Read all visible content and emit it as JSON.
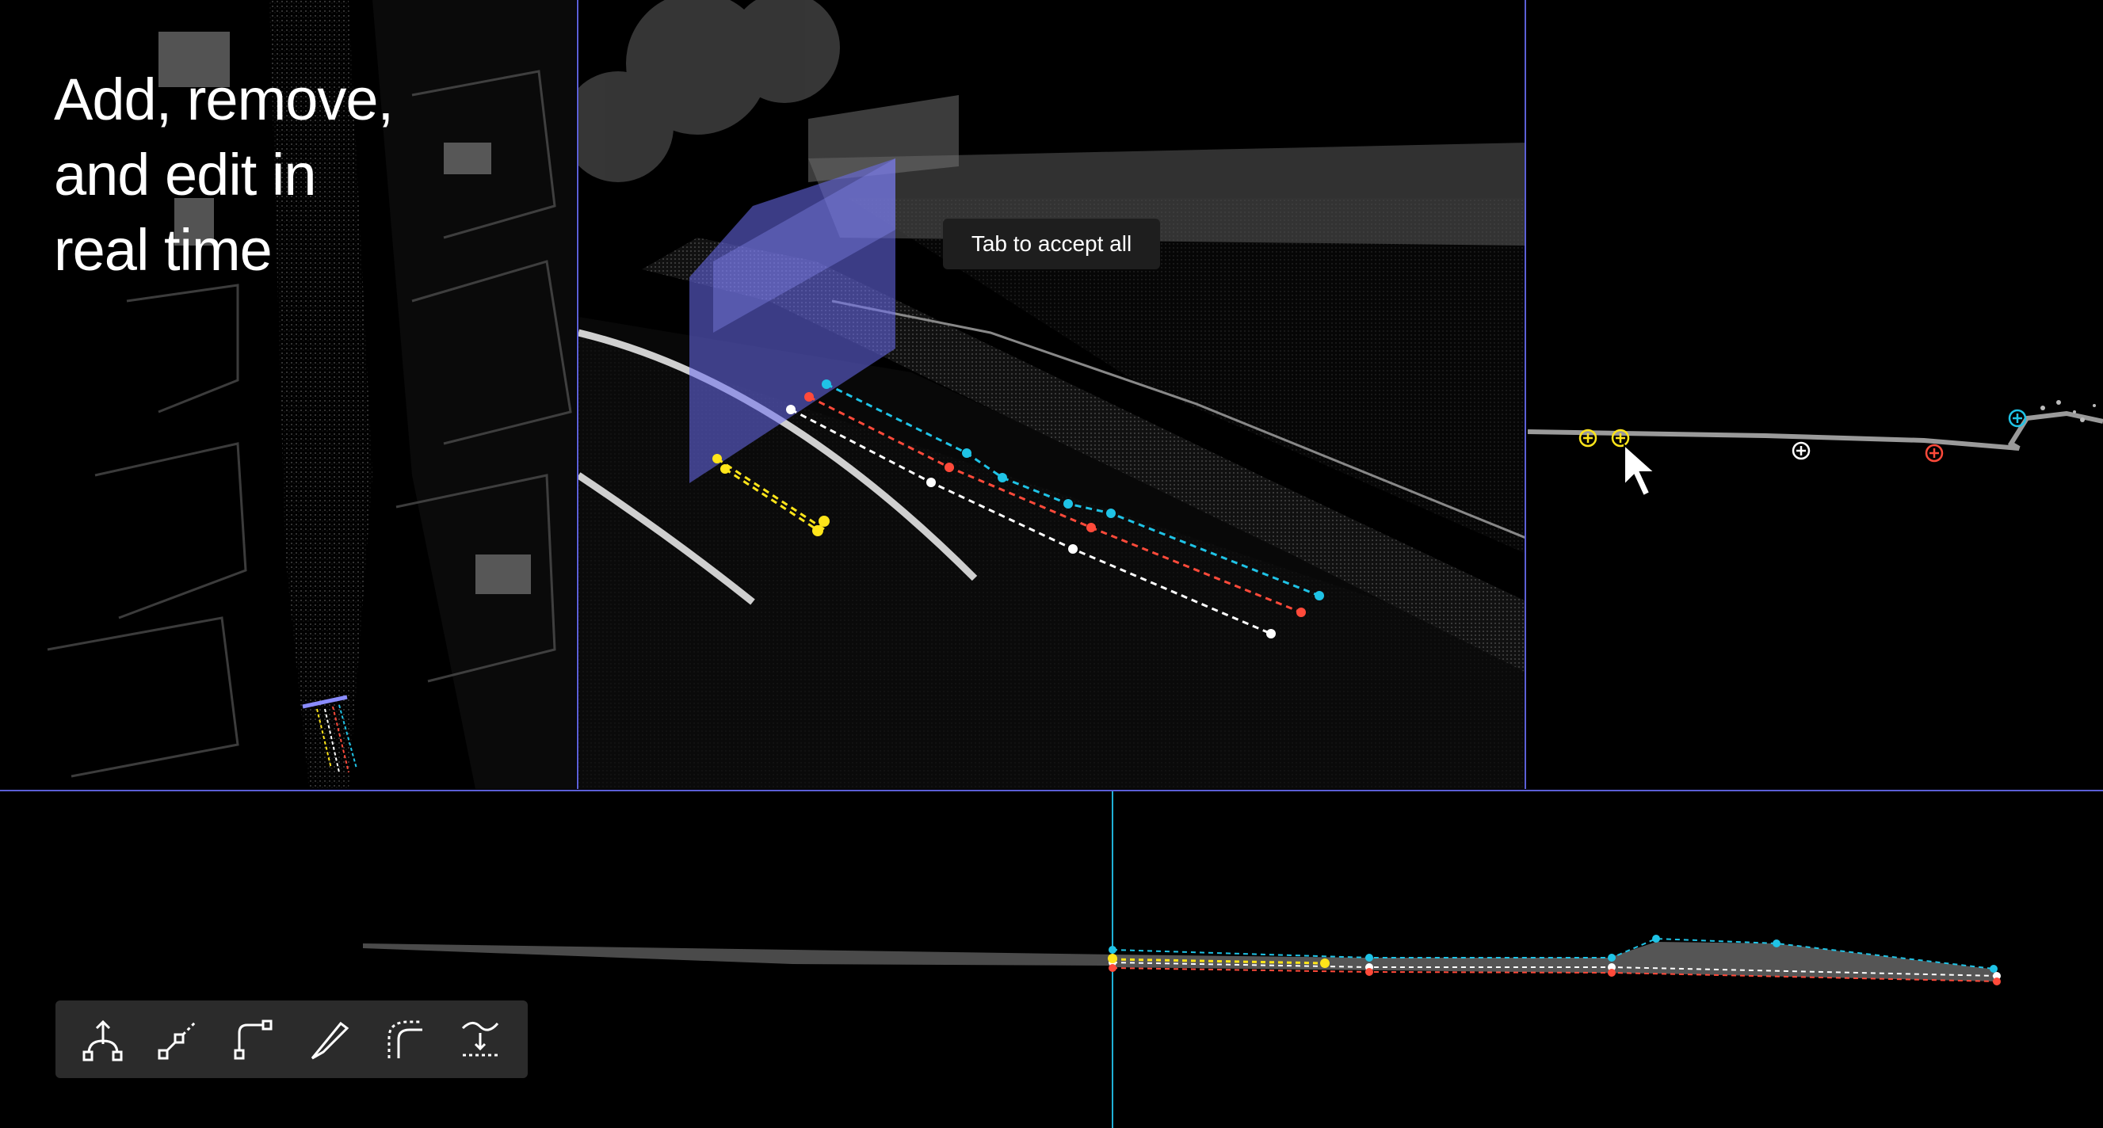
{
  "headline": {
    "line1": "Add, remove,",
    "line2": "and edit in",
    "line3": "real time"
  },
  "tooltip": {
    "text": "Tab to accept all"
  },
  "colors": {
    "accent": "#5b5fd6",
    "cyan": "#1fc3e6",
    "red": "#ff4a3a",
    "white": "#ffffff",
    "yellow": "#ffe51a"
  },
  "toolbar": {
    "tools": [
      {
        "name": "branch-tool",
        "icon": "branch-icon"
      },
      {
        "name": "line-segment-tool",
        "icon": "line-segment-icon"
      },
      {
        "name": "corner-tool",
        "icon": "corner-icon"
      },
      {
        "name": "blade-tool",
        "icon": "blade-icon"
      },
      {
        "name": "curve-offset-tool",
        "icon": "curve-offset-icon"
      },
      {
        "name": "snap-to-surface-tool",
        "icon": "snap-surface-icon"
      }
    ]
  }
}
